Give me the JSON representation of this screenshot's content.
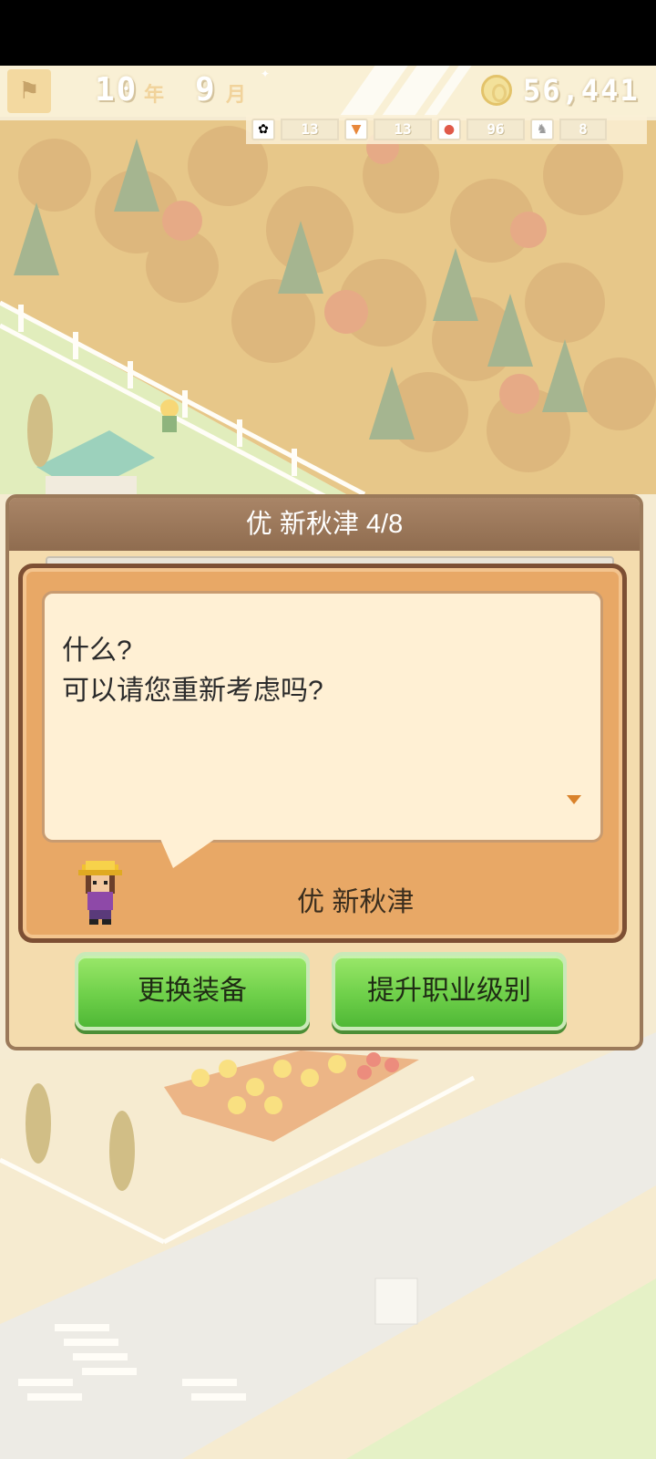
{
  "hud": {
    "year": "10",
    "year_unit": "年",
    "month": "9",
    "month_unit": "月",
    "money": "56,441",
    "resources": [
      {
        "icon": "flower-icon",
        "value": "13"
      },
      {
        "icon": "carrot-icon",
        "value": "13"
      },
      {
        "icon": "apple-icon",
        "value": "96"
      },
      {
        "icon": "cow-icon",
        "value": "8"
      }
    ]
  },
  "dialog": {
    "title": "优 新秋津 4/8",
    "speech_lines": [
      "什么?",
      "可以请您重新考虑吗?"
    ],
    "speaker": "优 新秋津",
    "buttons": {
      "equip": "更换装备",
      "upgrade": "提升职业级别"
    }
  },
  "colors": {
    "panel": "#f4dcae",
    "header": "#9b7a5a",
    "button_green": "#6fd04a"
  }
}
